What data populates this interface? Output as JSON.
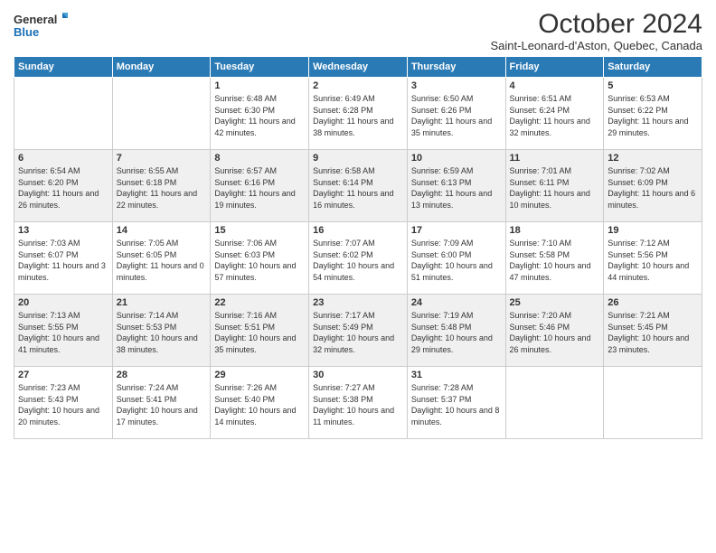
{
  "header": {
    "logo_line1": "General",
    "logo_line2": "Blue",
    "title": "October 2024",
    "subtitle": "Saint-Leonard-d'Aston, Quebec, Canada"
  },
  "days_of_week": [
    "Sunday",
    "Monday",
    "Tuesday",
    "Wednesday",
    "Thursday",
    "Friday",
    "Saturday"
  ],
  "weeks": [
    [
      {
        "day": "",
        "info": ""
      },
      {
        "day": "",
        "info": ""
      },
      {
        "day": "1",
        "info": "Sunrise: 6:48 AM\nSunset: 6:30 PM\nDaylight: 11 hours and 42 minutes."
      },
      {
        "day": "2",
        "info": "Sunrise: 6:49 AM\nSunset: 6:28 PM\nDaylight: 11 hours and 38 minutes."
      },
      {
        "day": "3",
        "info": "Sunrise: 6:50 AM\nSunset: 6:26 PM\nDaylight: 11 hours and 35 minutes."
      },
      {
        "day": "4",
        "info": "Sunrise: 6:51 AM\nSunset: 6:24 PM\nDaylight: 11 hours and 32 minutes."
      },
      {
        "day": "5",
        "info": "Sunrise: 6:53 AM\nSunset: 6:22 PM\nDaylight: 11 hours and 29 minutes."
      }
    ],
    [
      {
        "day": "6",
        "info": "Sunrise: 6:54 AM\nSunset: 6:20 PM\nDaylight: 11 hours and 26 minutes."
      },
      {
        "day": "7",
        "info": "Sunrise: 6:55 AM\nSunset: 6:18 PM\nDaylight: 11 hours and 22 minutes."
      },
      {
        "day": "8",
        "info": "Sunrise: 6:57 AM\nSunset: 6:16 PM\nDaylight: 11 hours and 19 minutes."
      },
      {
        "day": "9",
        "info": "Sunrise: 6:58 AM\nSunset: 6:14 PM\nDaylight: 11 hours and 16 minutes."
      },
      {
        "day": "10",
        "info": "Sunrise: 6:59 AM\nSunset: 6:13 PM\nDaylight: 11 hours and 13 minutes."
      },
      {
        "day": "11",
        "info": "Sunrise: 7:01 AM\nSunset: 6:11 PM\nDaylight: 11 hours and 10 minutes."
      },
      {
        "day": "12",
        "info": "Sunrise: 7:02 AM\nSunset: 6:09 PM\nDaylight: 11 hours and 6 minutes."
      }
    ],
    [
      {
        "day": "13",
        "info": "Sunrise: 7:03 AM\nSunset: 6:07 PM\nDaylight: 11 hours and 3 minutes."
      },
      {
        "day": "14",
        "info": "Sunrise: 7:05 AM\nSunset: 6:05 PM\nDaylight: 11 hours and 0 minutes."
      },
      {
        "day": "15",
        "info": "Sunrise: 7:06 AM\nSunset: 6:03 PM\nDaylight: 10 hours and 57 minutes."
      },
      {
        "day": "16",
        "info": "Sunrise: 7:07 AM\nSunset: 6:02 PM\nDaylight: 10 hours and 54 minutes."
      },
      {
        "day": "17",
        "info": "Sunrise: 7:09 AM\nSunset: 6:00 PM\nDaylight: 10 hours and 51 minutes."
      },
      {
        "day": "18",
        "info": "Sunrise: 7:10 AM\nSunset: 5:58 PM\nDaylight: 10 hours and 47 minutes."
      },
      {
        "day": "19",
        "info": "Sunrise: 7:12 AM\nSunset: 5:56 PM\nDaylight: 10 hours and 44 minutes."
      }
    ],
    [
      {
        "day": "20",
        "info": "Sunrise: 7:13 AM\nSunset: 5:55 PM\nDaylight: 10 hours and 41 minutes."
      },
      {
        "day": "21",
        "info": "Sunrise: 7:14 AM\nSunset: 5:53 PM\nDaylight: 10 hours and 38 minutes."
      },
      {
        "day": "22",
        "info": "Sunrise: 7:16 AM\nSunset: 5:51 PM\nDaylight: 10 hours and 35 minutes."
      },
      {
        "day": "23",
        "info": "Sunrise: 7:17 AM\nSunset: 5:49 PM\nDaylight: 10 hours and 32 minutes."
      },
      {
        "day": "24",
        "info": "Sunrise: 7:19 AM\nSunset: 5:48 PM\nDaylight: 10 hours and 29 minutes."
      },
      {
        "day": "25",
        "info": "Sunrise: 7:20 AM\nSunset: 5:46 PM\nDaylight: 10 hours and 26 minutes."
      },
      {
        "day": "26",
        "info": "Sunrise: 7:21 AM\nSunset: 5:45 PM\nDaylight: 10 hours and 23 minutes."
      }
    ],
    [
      {
        "day": "27",
        "info": "Sunrise: 7:23 AM\nSunset: 5:43 PM\nDaylight: 10 hours and 20 minutes."
      },
      {
        "day": "28",
        "info": "Sunrise: 7:24 AM\nSunset: 5:41 PM\nDaylight: 10 hours and 17 minutes."
      },
      {
        "day": "29",
        "info": "Sunrise: 7:26 AM\nSunset: 5:40 PM\nDaylight: 10 hours and 14 minutes."
      },
      {
        "day": "30",
        "info": "Sunrise: 7:27 AM\nSunset: 5:38 PM\nDaylight: 10 hours and 11 minutes."
      },
      {
        "day": "31",
        "info": "Sunrise: 7:28 AM\nSunset: 5:37 PM\nDaylight: 10 hours and 8 minutes."
      },
      {
        "day": "",
        "info": ""
      },
      {
        "day": "",
        "info": ""
      }
    ]
  ]
}
